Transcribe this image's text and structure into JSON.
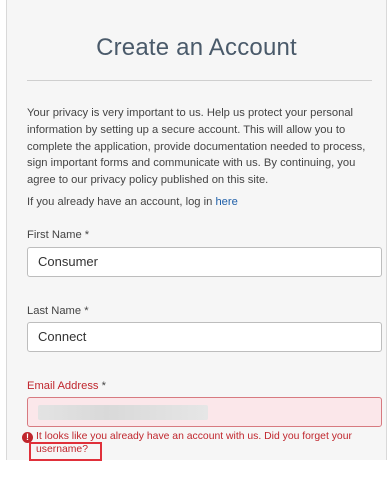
{
  "form": {
    "title": "Create an Account",
    "intro": "Your privacy is very important to us. Help us protect your personal information by setting up a secure account. This will allow you to complete the application, provide documentation needed to process, sign important forms and communicate with us. By continuing, you agree to our privacy policy published on this site.",
    "login_prompt": "If you already have an account, log in",
    "login_link": "here"
  },
  "fields": {
    "first_name": {
      "label": "First Name",
      "required_mark": " *",
      "value": "Consumer"
    },
    "last_name": {
      "label": "Last Name",
      "required_mark": " *",
      "value": "Connect"
    },
    "email": {
      "label": "Email Address",
      "required_mark": " *",
      "value": ""
    }
  },
  "error": {
    "icon": "!",
    "message": "It looks like you already have an account with us. Did you forget your",
    "link": "username",
    "suffix": "?"
  },
  "colors": {
    "error": "#c0262d",
    "link": "#1f5fa8",
    "error_field_bg": "#fbe7ea",
    "highlight": "#e0303a"
  }
}
